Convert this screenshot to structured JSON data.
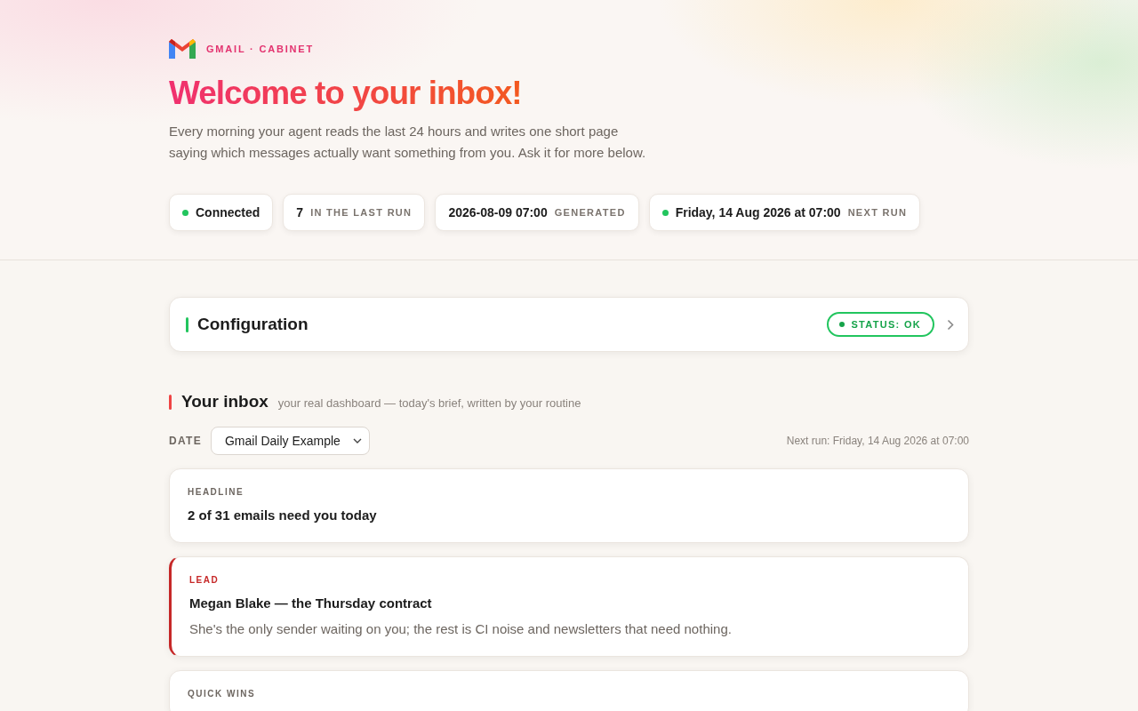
{
  "brand": {
    "label": "GMAIL · CABINET"
  },
  "hero": {
    "title": "Welcome to your inbox!",
    "intro": "Every morning your agent reads the last 24 hours and writes one short page saying which messages actually want something from you. Ask it for more below."
  },
  "chips": [
    {
      "value": "Connected",
      "color": "#22c55e"
    },
    {
      "value": "7",
      "label": "IN THE LAST RUN"
    },
    {
      "value": "2026-08-09 07:00",
      "label": "GENERATED"
    },
    {
      "value": "Friday, 14 Aug 2026 at 07:00",
      "label": "NEXT RUN",
      "color": "#22c55e"
    }
  ],
  "configuration": {
    "title": "Configuration",
    "status": "STATUS: OK",
    "expanded": false
  },
  "inbox": {
    "title": "Your inbox",
    "subtitle": "your real dashboard — today's brief, written by your routine",
    "date_label": "DATE",
    "date_value": "Gmail Daily Example",
    "next_run": "Next run: Friday, 14 Aug 2026 at 07:00"
  },
  "cards": [
    {
      "kind": "headline",
      "label": "HEADLINE",
      "title": "2 of 31 emails need you today"
    },
    {
      "kind": "lead",
      "label": "LEAD",
      "title": "Megan Blake — the Thursday contract",
      "body": "She's the only sender waiting on you; the rest is CI noise and newsletters that need nothing."
    },
    {
      "kind": "section",
      "label": "QUICK WINS"
    }
  ]
}
